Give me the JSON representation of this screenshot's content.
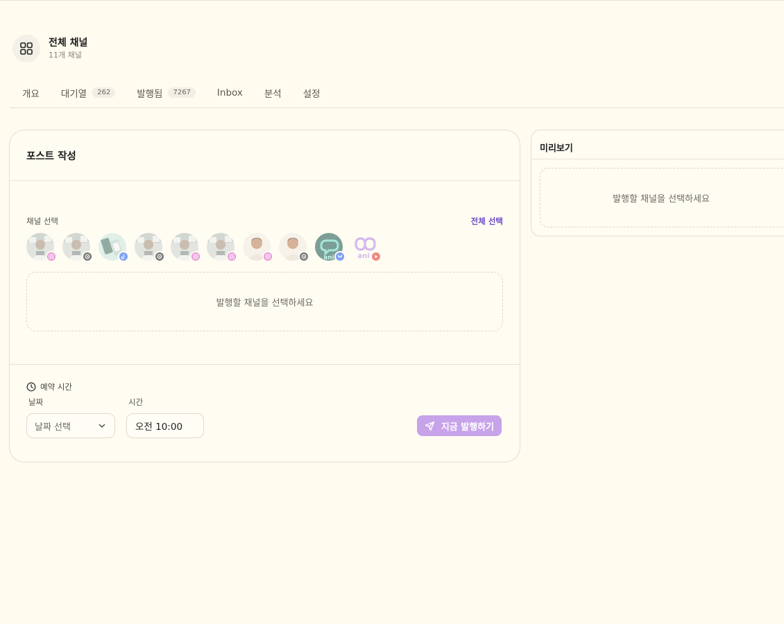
{
  "header": {
    "title": "전체 채널",
    "subtitle": "11개 채널"
  },
  "tabs": [
    {
      "label": "개요",
      "count": ""
    },
    {
      "label": "대기열",
      "count": "262"
    },
    {
      "label": "발행됨",
      "count": "7267"
    },
    {
      "label": "Inbox",
      "count": ""
    },
    {
      "label": "분석",
      "count": ""
    },
    {
      "label": "설정",
      "count": ""
    }
  ],
  "composer": {
    "title": "포스트 작성",
    "channel_select_label": "채널 선택",
    "select_all_label": "전체 선택",
    "dropzone_text": "발행할 채널을 선택하세요",
    "channels": [
      {
        "avatar": "person-photo",
        "platform": "instagram-icon",
        "badge_color": "#e58fd6"
      },
      {
        "avatar": "person-photo",
        "platform": "threads-icon",
        "badge_color": "#7b7b7b"
      },
      {
        "avatar": "phone-photo",
        "platform": "tiktok-icon",
        "badge_color": "#7fa2f5"
      },
      {
        "avatar": "person-photo",
        "platform": "threads-icon",
        "badge_color": "#7b7b7b"
      },
      {
        "avatar": "person-photo",
        "platform": "instagram-icon",
        "badge_color": "#e58fd6"
      },
      {
        "avatar": "person-photo",
        "platform": "instagram-icon",
        "badge_color": "#e58fd6"
      },
      {
        "avatar": "portrait-photo",
        "platform": "instagram-icon",
        "badge_color": "#e58fd6"
      },
      {
        "avatar": "portrait-photo",
        "platform": "threads-icon",
        "badge_color": "#7b7b7b"
      },
      {
        "avatar": "ani-logo-dark",
        "platform": "bluesky-icon",
        "badge_color": "#7fa2f5"
      },
      {
        "avatar": "ani-logo-light",
        "platform": "youtube-icon",
        "badge_color": "#ee8a80"
      }
    ],
    "schedule_label": "예약 시간",
    "date_label": "날짜",
    "date_placeholder": "날짜 선택",
    "time_label": "시간",
    "time_value": "오전 10:00",
    "publish_label": "지금 발행하기",
    "accent_color": "#c7a3ea"
  },
  "preview": {
    "title": "미리보기",
    "empty_text": "발행할 채널을 선택하세요"
  }
}
